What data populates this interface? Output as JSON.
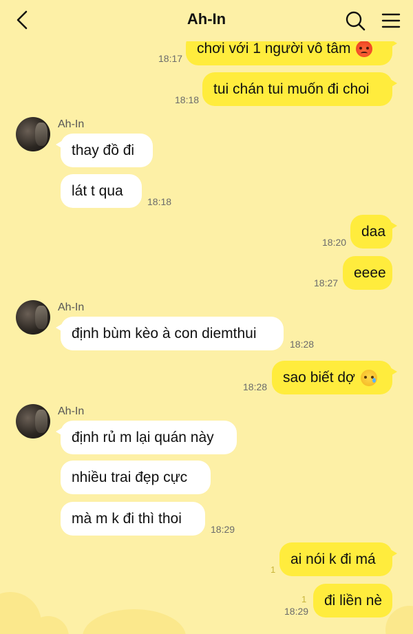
{
  "header": {
    "title": "Ah-In",
    "back_icon": "chevron-left-icon",
    "search_icon": "search-icon",
    "menu_icon": "menu-icon"
  },
  "colors": {
    "background": "#fdf0a6",
    "outgoing_bubble": "#ffec3d",
    "incoming_bubble": "#ffffff"
  },
  "messages": [
    {
      "side": "right",
      "text": "chơi với 1 người vô tâm",
      "emoji": "angry-face-icon",
      "time": "18:17"
    },
    {
      "side": "right",
      "text": "tui chán tui muốn đi choi",
      "time": "18:18"
    },
    {
      "side": "left",
      "sender": "Ah-In",
      "text": "thay đồ đi"
    },
    {
      "side": "left",
      "text": "lát t qua",
      "time": "18:18"
    },
    {
      "side": "right",
      "text": "daa",
      "time": "18:20"
    },
    {
      "side": "right",
      "text": "eeee",
      "time": "18:27"
    },
    {
      "side": "left",
      "sender": "Ah-In",
      "text": "định bùm kèo à con diemthui",
      "time": "18:28"
    },
    {
      "side": "right",
      "text": "sao biết dợ",
      "emoji": "crying-smile-icon",
      "time": "18:28"
    },
    {
      "side": "left",
      "sender": "Ah-In",
      "text": "định rủ m lại quán này"
    },
    {
      "side": "left",
      "text": "nhiều trai đẹp cực"
    },
    {
      "side": "left",
      "text": "mà m k đi thì thoi",
      "time": "18:29"
    },
    {
      "side": "right",
      "text": "ai nói k đi má",
      "unread": "1"
    },
    {
      "side": "right",
      "text": "đi liền nè",
      "unread": "1",
      "time": "18:29"
    }
  ]
}
